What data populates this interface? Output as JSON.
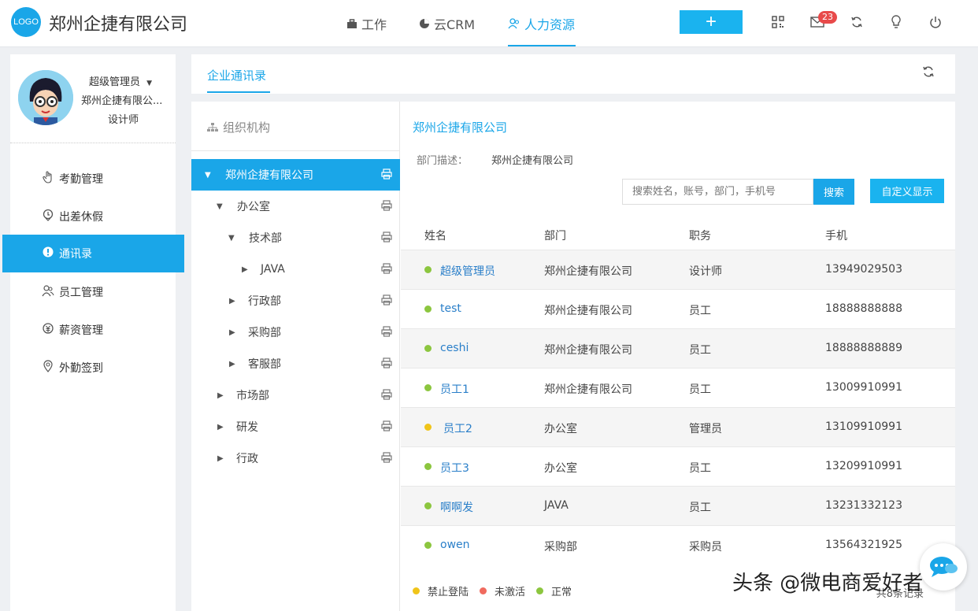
{
  "header": {
    "logo_text": "LOGO",
    "company_title": "郑州企捷有限公司",
    "nav": [
      {
        "label": "工作",
        "icon": "briefcase-icon"
      },
      {
        "label": "云CRM",
        "icon": "pie-icon"
      },
      {
        "label": "人力资源",
        "icon": "people-icon",
        "active": true
      }
    ],
    "add_label": "+",
    "mail_badge": "23"
  },
  "user": {
    "name": "超级管理员",
    "company": "郑州企捷有限公...",
    "role": "设计师"
  },
  "sidebar": {
    "items": [
      {
        "label": "考勤管理",
        "icon": "hand-icon"
      },
      {
        "label": "出差休假",
        "icon": "location-icon"
      },
      {
        "label": "通讯录",
        "icon": "contact-icon",
        "active": true
      },
      {
        "label": "员工管理",
        "icon": "users-icon"
      },
      {
        "label": "薪资管理",
        "icon": "money-icon"
      },
      {
        "label": "外勤签到",
        "icon": "pin-icon"
      }
    ]
  },
  "tabs": {
    "active": "企业通讯录"
  },
  "org": {
    "title": "组织机构",
    "tree": [
      {
        "label": "郑州企捷有限公司",
        "level": 0,
        "expanded": true,
        "selected": true
      },
      {
        "label": "办公室",
        "level": 1,
        "expanded": true
      },
      {
        "label": "技术部",
        "level": 2,
        "expanded": true
      },
      {
        "label": "JAVA",
        "level": 3,
        "expanded": false
      },
      {
        "label": "行政部",
        "level": 2,
        "expanded": false
      },
      {
        "label": "采购部",
        "level": 2,
        "expanded": false
      },
      {
        "label": "客服部",
        "level": 2,
        "expanded": false
      },
      {
        "label": "市场部",
        "level": 1,
        "expanded": false
      },
      {
        "label": "研发",
        "level": 1,
        "expanded": false
      },
      {
        "label": "行政",
        "level": 1,
        "expanded": false
      }
    ]
  },
  "detail": {
    "title": "郑州企捷有限公司",
    "desc_label": "部门描述：",
    "desc_value": "郑州企捷有限公司",
    "search_placeholder": "搜索姓名，账号，部门，手机号",
    "search_label": "搜索",
    "custom_label": "自定义显示",
    "columns": [
      "姓名",
      "部门",
      "职务",
      "手机"
    ],
    "rows": [
      {
        "name": "超级管理员",
        "dept": "郑州企捷有限公司",
        "role": "设计师",
        "phone": "13949029503",
        "status": "green"
      },
      {
        "name": "test",
        "dept": "郑州企捷有限公司",
        "role": "员工",
        "phone": "18888888888",
        "status": "green"
      },
      {
        "name": "ceshi",
        "dept": "郑州企捷有限公司",
        "role": "员工",
        "phone": "18888888889",
        "status": "green"
      },
      {
        "name": "员工1",
        "dept": "郑州企捷有限公司",
        "role": "员工",
        "phone": "13009910991",
        "status": "green"
      },
      {
        "name": "员工2",
        "dept": "办公室",
        "role": "管理员",
        "phone": "13109910991",
        "status": "yellow"
      },
      {
        "name": "员工3",
        "dept": "办公室",
        "role": "员工",
        "phone": "13209910991",
        "status": "green"
      },
      {
        "name": "啊啊发",
        "dept": "JAVA",
        "role": "员工",
        "phone": "13231332123",
        "status": "green"
      },
      {
        "name": "owen",
        "dept": "采购部",
        "role": "采购员",
        "phone": "13564321925",
        "status": "green"
      }
    ],
    "legend": [
      {
        "label": "禁止登陆",
        "color": "#f0c419"
      },
      {
        "label": "未激活",
        "color": "#f06a5e"
      },
      {
        "label": "正常",
        "color": "#8cc63f"
      }
    ],
    "count_text": "共8条记录"
  },
  "watermark": "头条 @微电商爱好者",
  "colors": {
    "accent": "#1aa6e8",
    "green": "#8cc63f",
    "yellow": "#f0c419",
    "red": "#f06a5e"
  }
}
